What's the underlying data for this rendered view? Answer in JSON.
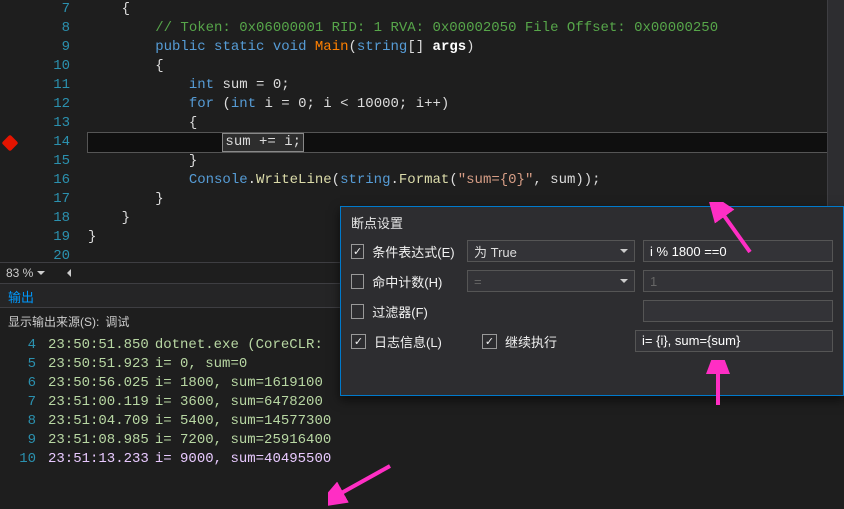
{
  "code": {
    "lines": [
      {
        "n": 7,
        "html": "    <span class='tok-plain'>{</span>"
      },
      {
        "n": 8,
        "html": "        <span class='tok-comment'>// Token: 0x06000001 RID: 1 RVA: 0x00002050 File Offset: 0x00000250</span>"
      },
      {
        "n": 9,
        "html": "        <span class='tok-keyword'>public</span> <span class='tok-keyword'>static</span> <span class='tok-keyword'>void</span> <span class='tok-method'>Main</span><span class='tok-plain'>(</span><span class='tok-keyword'>string</span><span class='tok-plain'>[]</span> <span class='tok-var'>args</span><span class='tok-plain'>)</span>"
      },
      {
        "n": 10,
        "html": "        <span class='tok-plain'>{</span>"
      },
      {
        "n": 11,
        "html": "            <span class='tok-keyword'>int</span> <span class='tok-plain'>sum = 0;</span>"
      },
      {
        "n": 12,
        "html": "            <span class='tok-keyword'>for</span> <span class='tok-plain'>(</span><span class='tok-keyword'>int</span> <span class='tok-plain'>i = 0; i &lt; 10000; i++)</span>"
      },
      {
        "n": 13,
        "html": "            <span class='tok-plain'>{</span>"
      },
      {
        "n": 14,
        "html": "                <span class='hilite-expr'><span class='tok-plain'>sum += i;</span></span>",
        "current": true,
        "bp": true
      },
      {
        "n": 15,
        "html": "            <span class='tok-plain'>}</span>"
      },
      {
        "n": 16,
        "html": "            <span class='tok-type'>Console</span><span class='tok-plain'>.</span><span class='tok-ident'>WriteLine</span><span class='tok-plain'>(</span><span class='tok-keyword'>string</span><span class='tok-plain'>.</span><span class='tok-ident'>Format</span><span class='tok-plain'>(</span><span class='tok-str'>\"sum={0}\"</span><span class='tok-plain'>, sum));</span>"
      },
      {
        "n": 17,
        "html": "        <span class='tok-plain'>}</span>"
      },
      {
        "n": 18,
        "html": "    <span class='tok-plain'>}</span>"
      },
      {
        "n": 19,
        "html": "<span class='tok-plain'>}</span>"
      },
      {
        "n": 20,
        "html": ""
      }
    ]
  },
  "zoom": {
    "percent": "83 %"
  },
  "output": {
    "panel_title": "输出",
    "source_label": "显示输出来源(S):",
    "source_value": "调试",
    "lines": [
      {
        "n": 4,
        "time": "23:50:51.850",
        "text": "dotnet.exe (CoreCLR:"
      },
      {
        "n": 5,
        "time": "23:50:51.923",
        "text": "i= 0, sum=0"
      },
      {
        "n": 6,
        "time": "23:50:56.025",
        "text": "i= 1800, sum=1619100"
      },
      {
        "n": 7,
        "time": "23:51:00.119",
        "text": "i= 3600, sum=6478200"
      },
      {
        "n": 8,
        "time": "23:51:04.709",
        "text": "i= 5400, sum=14577300"
      },
      {
        "n": 9,
        "time": "23:51:08.985",
        "text": "i= 7200, sum=25916400"
      },
      {
        "n": 10,
        "time": "23:51:13.233",
        "text": "i= 9000, sum=40495500",
        "last": true
      }
    ]
  },
  "bp": {
    "title": "断点设置",
    "rows": {
      "cond": {
        "checked": true,
        "label": "条件表达式(E)",
        "combo": "为 True",
        "value": "i % 1800 ==0"
      },
      "hit": {
        "checked": false,
        "label": "命中计数(H)",
        "combo": "=",
        "value": "1"
      },
      "filter": {
        "checked": false,
        "label": "过滤器(F)"
      },
      "log": {
        "checked": true,
        "label": "日志信息(L)",
        "cont_checked": true,
        "cont_label": "继续执行",
        "value": "i= {i}, sum={sum}"
      }
    }
  }
}
